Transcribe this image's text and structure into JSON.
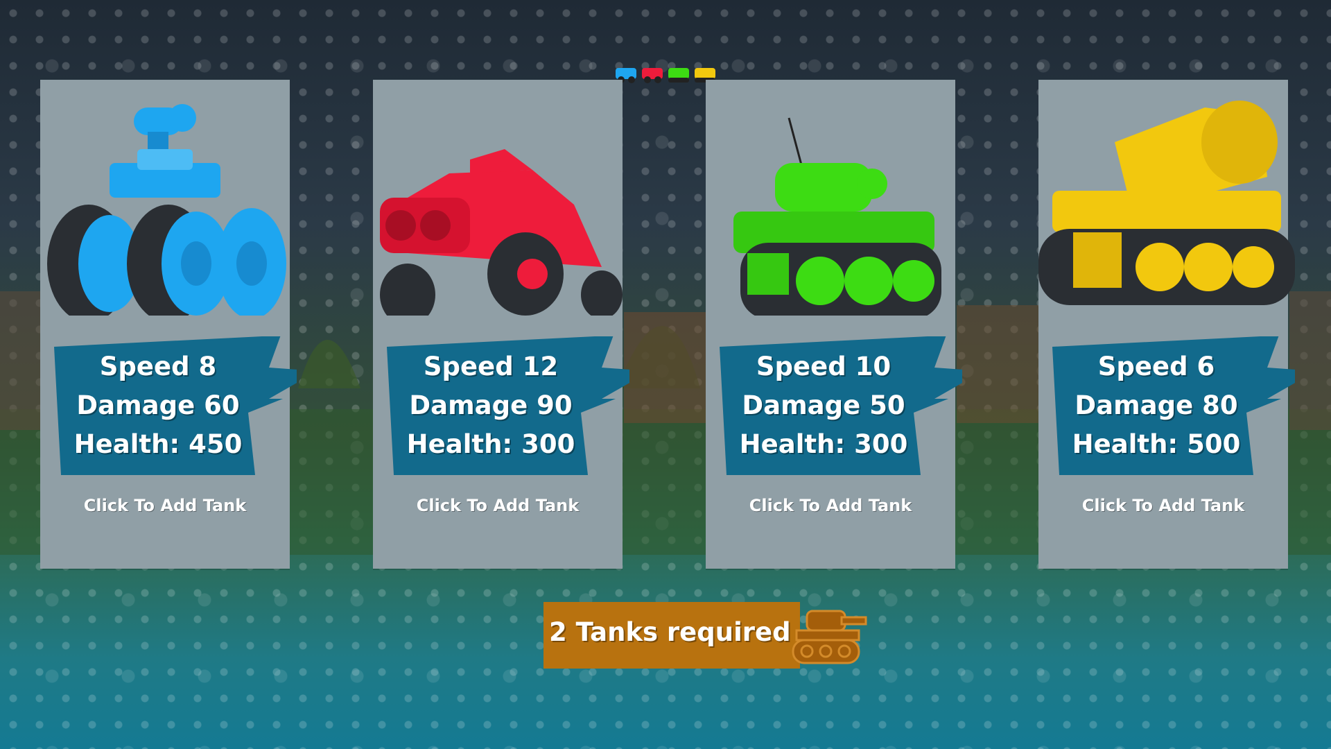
{
  "queue": {
    "icons": [
      "blue-tank-icon",
      "red-tank-icon",
      "green-tank-icon",
      "yellow-tank-icon"
    ]
  },
  "cards": [
    {
      "vehicle": "blue-monster-truck",
      "color": "#1ea6f0",
      "speed": "Speed 8",
      "damage": "Damage 60",
      "health": "Health: 450",
      "action": "Click To Add Tank"
    },
    {
      "vehicle": "red-racer",
      "color": "#ee1c3b",
      "speed": "Speed 12",
      "damage": "Damage 90",
      "health": "Health: 300",
      "action": "Click To Add Tank"
    },
    {
      "vehicle": "green-tank",
      "color": "#3ddc13",
      "speed": "Speed 10",
      "damage": "Damage 50",
      "health": "Health: 300",
      "action": "Click To Add Tank"
    },
    {
      "vehicle": "yellow-drill-tank",
      "color": "#f2c80e",
      "speed": "Speed 6",
      "damage": "Damage 80",
      "health": "Health: 500",
      "action": "Click To Add Tank"
    }
  ],
  "footer": {
    "required_text": "2 Tanks required",
    "icon": "tank-icon"
  },
  "colors": {
    "card_bg": "#909fa6",
    "banner": "#126a8c",
    "required_bg": "#b8720f"
  }
}
